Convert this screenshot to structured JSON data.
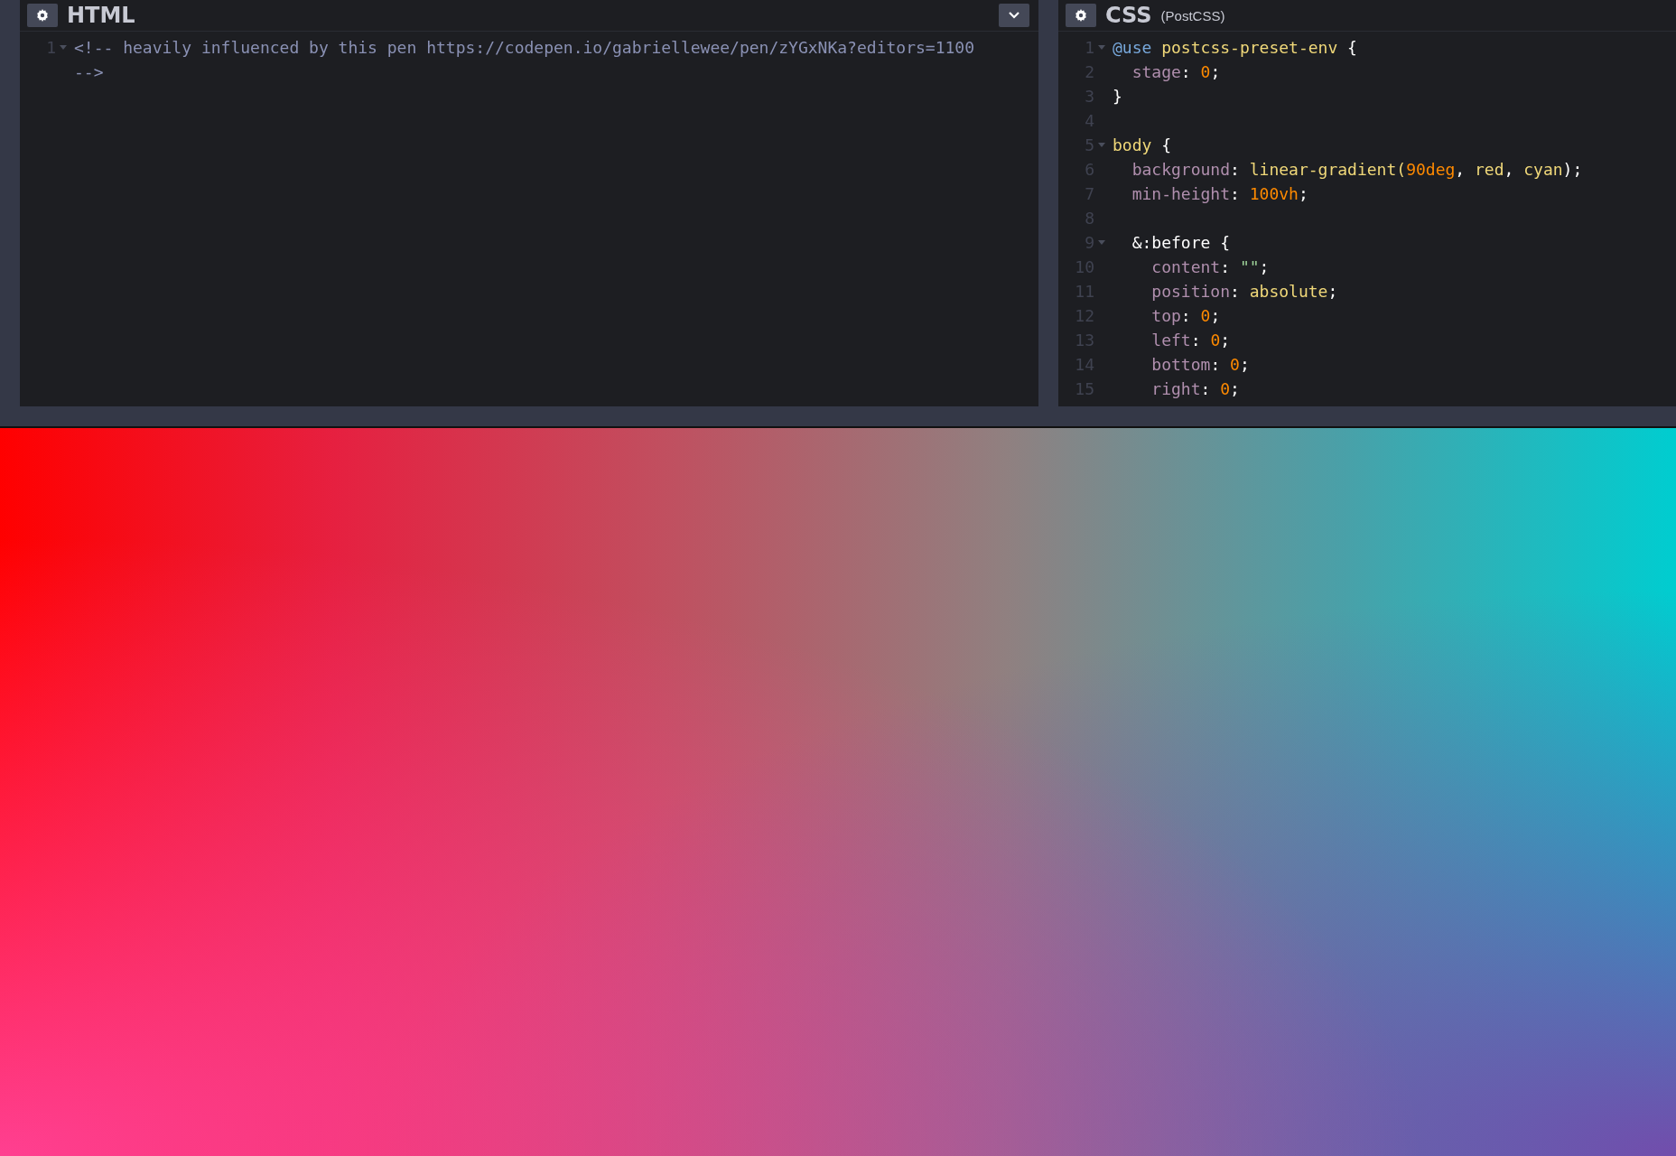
{
  "editors": [
    {
      "title": "HTML",
      "has_menu": true,
      "lines": [
        {
          "number": "1",
          "fold": true,
          "tokens": [
            {
              "kind": "comment",
              "text": "<!-- heavily influenced by this pen https://codepen.io/gabriellewee/pen/zYGxNKa?editors=1100"
            }
          ]
        },
        {
          "fold": false,
          "tokens": [
            {
              "kind": "comment",
              "text": "-->"
            }
          ]
        }
      ]
    },
    {
      "title": "CSS",
      "subtitle": "(PostCSS)",
      "has_menu": false,
      "lines": [
        {
          "number": "1",
          "fold": true,
          "tokens": [
            {
              "kind": "atrule",
              "text": "@use"
            },
            {
              "kind": "value",
              "text": " postcss-preset-env"
            },
            {
              "kind": "punct",
              "text": " {"
            }
          ]
        },
        {
          "number": "2",
          "fold": false,
          "tokens": [
            {
              "kind": "prop",
              "text": "  stage"
            },
            {
              "kind": "punct",
              "text": ": "
            },
            {
              "kind": "num",
              "text": "0"
            },
            {
              "kind": "punct",
              "text": ";"
            }
          ]
        },
        {
          "number": "3",
          "fold": false,
          "tokens": [
            {
              "kind": "punct",
              "text": "}"
            }
          ]
        },
        {
          "number": "4",
          "fold": false
        },
        {
          "number": "5",
          "fold": true,
          "tokens": [
            {
              "kind": "value",
              "text": "body"
            },
            {
              "kind": "punct",
              "text": " {"
            }
          ]
        },
        {
          "number": "6",
          "fold": false,
          "tokens": [
            {
              "kind": "prop",
              "text": "  background"
            },
            {
              "kind": "punct",
              "text": ": "
            },
            {
              "kind": "value",
              "text": "linear-gradient("
            },
            {
              "kind": "num",
              "text": "90deg"
            },
            {
              "kind": "punct",
              "text": ", "
            },
            {
              "kind": "value",
              "text": "red"
            },
            {
              "kind": "punct",
              "text": ", "
            },
            {
              "kind": "value",
              "text": "cyan"
            },
            {
              "kind": "punct",
              "text": ");"
            }
          ]
        },
        {
          "number": "7",
          "fold": false,
          "tokens": [
            {
              "kind": "prop",
              "text": "  min-height"
            },
            {
              "kind": "punct",
              "text": ": "
            },
            {
              "kind": "num",
              "text": "100vh"
            },
            {
              "kind": "punct",
              "text": ";"
            }
          ]
        },
        {
          "number": "8",
          "fold": false
        },
        {
          "number": "9",
          "fold": true,
          "tokens": [
            {
              "kind": "punct",
              "text": "  &:before {"
            }
          ]
        },
        {
          "number": "10",
          "fold": false,
          "tokens": [
            {
              "kind": "prop",
              "text": "    content"
            },
            {
              "kind": "punct",
              "text": ": "
            },
            {
              "kind": "string",
              "text": "\"\""
            },
            {
              "kind": "punct",
              "text": ";"
            }
          ]
        },
        {
          "number": "11",
          "fold": false,
          "tokens": [
            {
              "kind": "prop",
              "text": "    position"
            },
            {
              "kind": "punct",
              "text": ": "
            },
            {
              "kind": "value",
              "text": "absolute"
            },
            {
              "kind": "punct",
              "text": ";"
            }
          ]
        },
        {
          "number": "12",
          "fold": false,
          "tokens": [
            {
              "kind": "prop",
              "text": "    top"
            },
            {
              "kind": "punct",
              "text": ": "
            },
            {
              "kind": "num",
              "text": "0"
            },
            {
              "kind": "punct",
              "text": ";"
            }
          ]
        },
        {
          "number": "13",
          "fold": false,
          "tokens": [
            {
              "kind": "prop",
              "text": "    left"
            },
            {
              "kind": "punct",
              "text": ": "
            },
            {
              "kind": "num",
              "text": "0"
            },
            {
              "kind": "punct",
              "text": ";"
            }
          ]
        },
        {
          "number": "14",
          "fold": false,
          "tokens": [
            {
              "kind": "prop",
              "text": "    bottom"
            },
            {
              "kind": "punct",
              "text": ": "
            },
            {
              "kind": "num",
              "text": "0"
            },
            {
              "kind": "punct",
              "text": ";"
            }
          ]
        },
        {
          "number": "15",
          "fold": false,
          "tokens": [
            {
              "kind": "prop",
              "text": "    right"
            },
            {
              "kind": "punct",
              "text": ": "
            },
            {
              "kind": "num",
              "text": "0"
            },
            {
              "kind": "punct",
              "text": ";"
            }
          ]
        }
      ]
    }
  ]
}
